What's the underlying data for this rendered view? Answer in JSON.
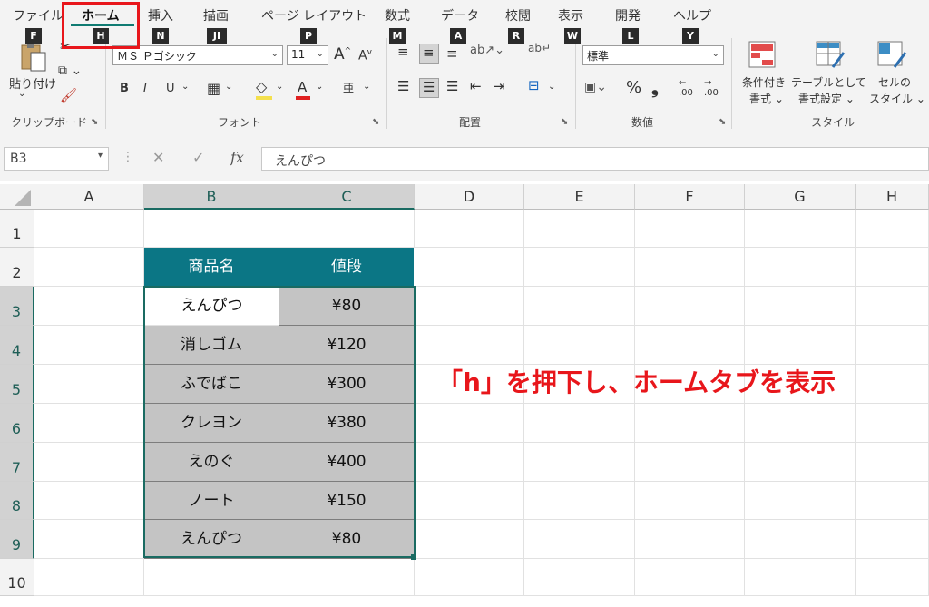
{
  "tabs": [
    {
      "label": "ファイル",
      "key": "F"
    },
    {
      "label": "ホーム",
      "key": "H"
    },
    {
      "label": "挿入",
      "key": "N"
    },
    {
      "label": "描画",
      "key": "JI"
    },
    {
      "label": "ページ レイアウト",
      "key": "P"
    },
    {
      "label": "数式",
      "key": "M"
    },
    {
      "label": "データ",
      "key": "A"
    },
    {
      "label": "校閲",
      "key": "R"
    },
    {
      "label": "表示",
      "key": "W"
    },
    {
      "label": "開発",
      "key": "L"
    },
    {
      "label": "ヘルプ",
      "key": "Y"
    }
  ],
  "ribbon": {
    "clipboard": {
      "paste_label": "貼り付け",
      "group_label": "クリップボード"
    },
    "font": {
      "font_name": "ＭＳ Ｐゴシック",
      "font_size": "11",
      "group_label": "フォント",
      "grow": "A",
      "shrink": "A",
      "bold": "B",
      "italic": "I",
      "underline": "U",
      "font_color": "A",
      "phonetic": "亜"
    },
    "alignment": {
      "group_label": "配置"
    },
    "number": {
      "format": "標準",
      "group_label": "数値",
      "percent": "%",
      "comma": "❟",
      "inc_decimal": ".00",
      "dec_decimal": ".00"
    },
    "styles": {
      "group_label": "スタイル",
      "conditional_l1": "条件付き",
      "conditional_l2": "書式",
      "table_l1": "テーブルとして",
      "table_l2": "書式設定",
      "cell_l1": "セルの",
      "cell_l2": "スタイル"
    }
  },
  "formula_bar": {
    "name_box": "B3",
    "fx": "fx",
    "value": "えんぴつ",
    "cancel": "✕",
    "enter": "✓"
  },
  "columns": [
    "A",
    "B",
    "C",
    "D",
    "E",
    "F",
    "G",
    "H"
  ],
  "rows": [
    "1",
    "2",
    "3",
    "4",
    "5",
    "6",
    "7",
    "8",
    "9",
    "10"
  ],
  "table": {
    "headers": [
      "商品名",
      "値段"
    ],
    "rows": [
      [
        "えんぴつ",
        "¥80"
      ],
      [
        "消しゴム",
        "¥120"
      ],
      [
        "ふでばこ",
        "¥300"
      ],
      [
        "クレヨン",
        "¥380"
      ],
      [
        "えのぐ",
        "¥400"
      ],
      [
        "ノート",
        "¥150"
      ],
      [
        "えんぴつ",
        "¥80"
      ]
    ]
  },
  "callout": "「h」を押下し、ホームタブを表示",
  "colors": {
    "accent": "#0b7685",
    "highlight": "#e8161b",
    "selection": "#1a6b62"
  }
}
